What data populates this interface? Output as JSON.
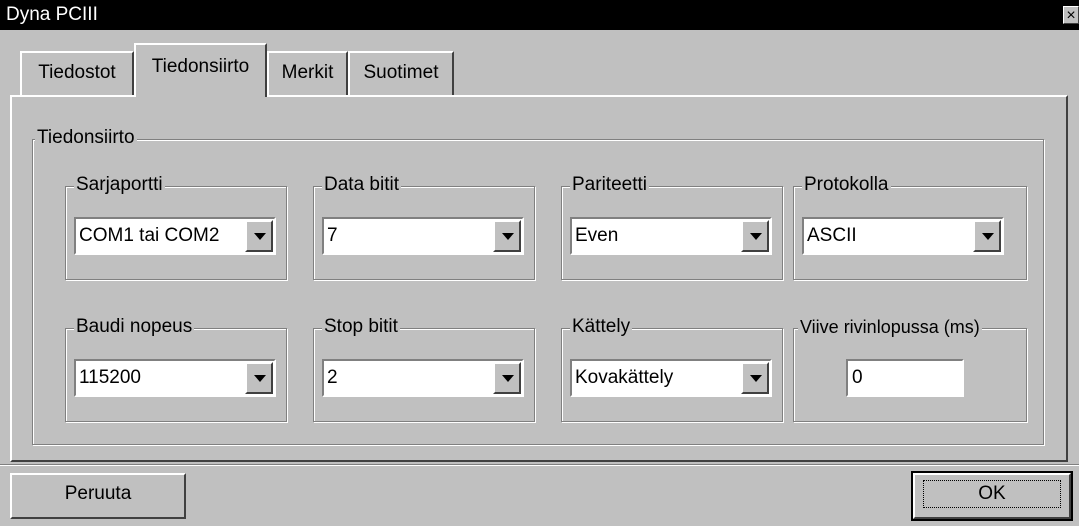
{
  "window": {
    "title": "Dyna PCIII",
    "close_glyph": "×"
  },
  "tabs": [
    {
      "label": "Tiedostot"
    },
    {
      "label": "Tiedonsiirto"
    },
    {
      "label": "Merkit"
    },
    {
      "label": "Suotimet"
    }
  ],
  "active_tab": "Tiedonsiirto",
  "group": {
    "title": "Tiedonsiirto",
    "sarjaportti": {
      "label": "Sarjaportti",
      "value": "COM1 tai COM2"
    },
    "data_bitit": {
      "label": "Data bitit",
      "value": "7"
    },
    "pariteetti": {
      "label": "Pariteetti",
      "value": "Even"
    },
    "protokolla": {
      "label": "Protokolla",
      "value": "ASCII"
    },
    "baudi": {
      "label": "Baudi nopeus",
      "value": "115200"
    },
    "stop_bitit": {
      "label": "Stop bitit",
      "value": "2"
    },
    "kattely": {
      "label": "Kättely",
      "value": "Kovakättely"
    },
    "viive": {
      "label": "Viive rivinlopussa (ms)",
      "value": "0"
    }
  },
  "buttons": {
    "cancel": "Peruuta",
    "ok": "OK"
  }
}
